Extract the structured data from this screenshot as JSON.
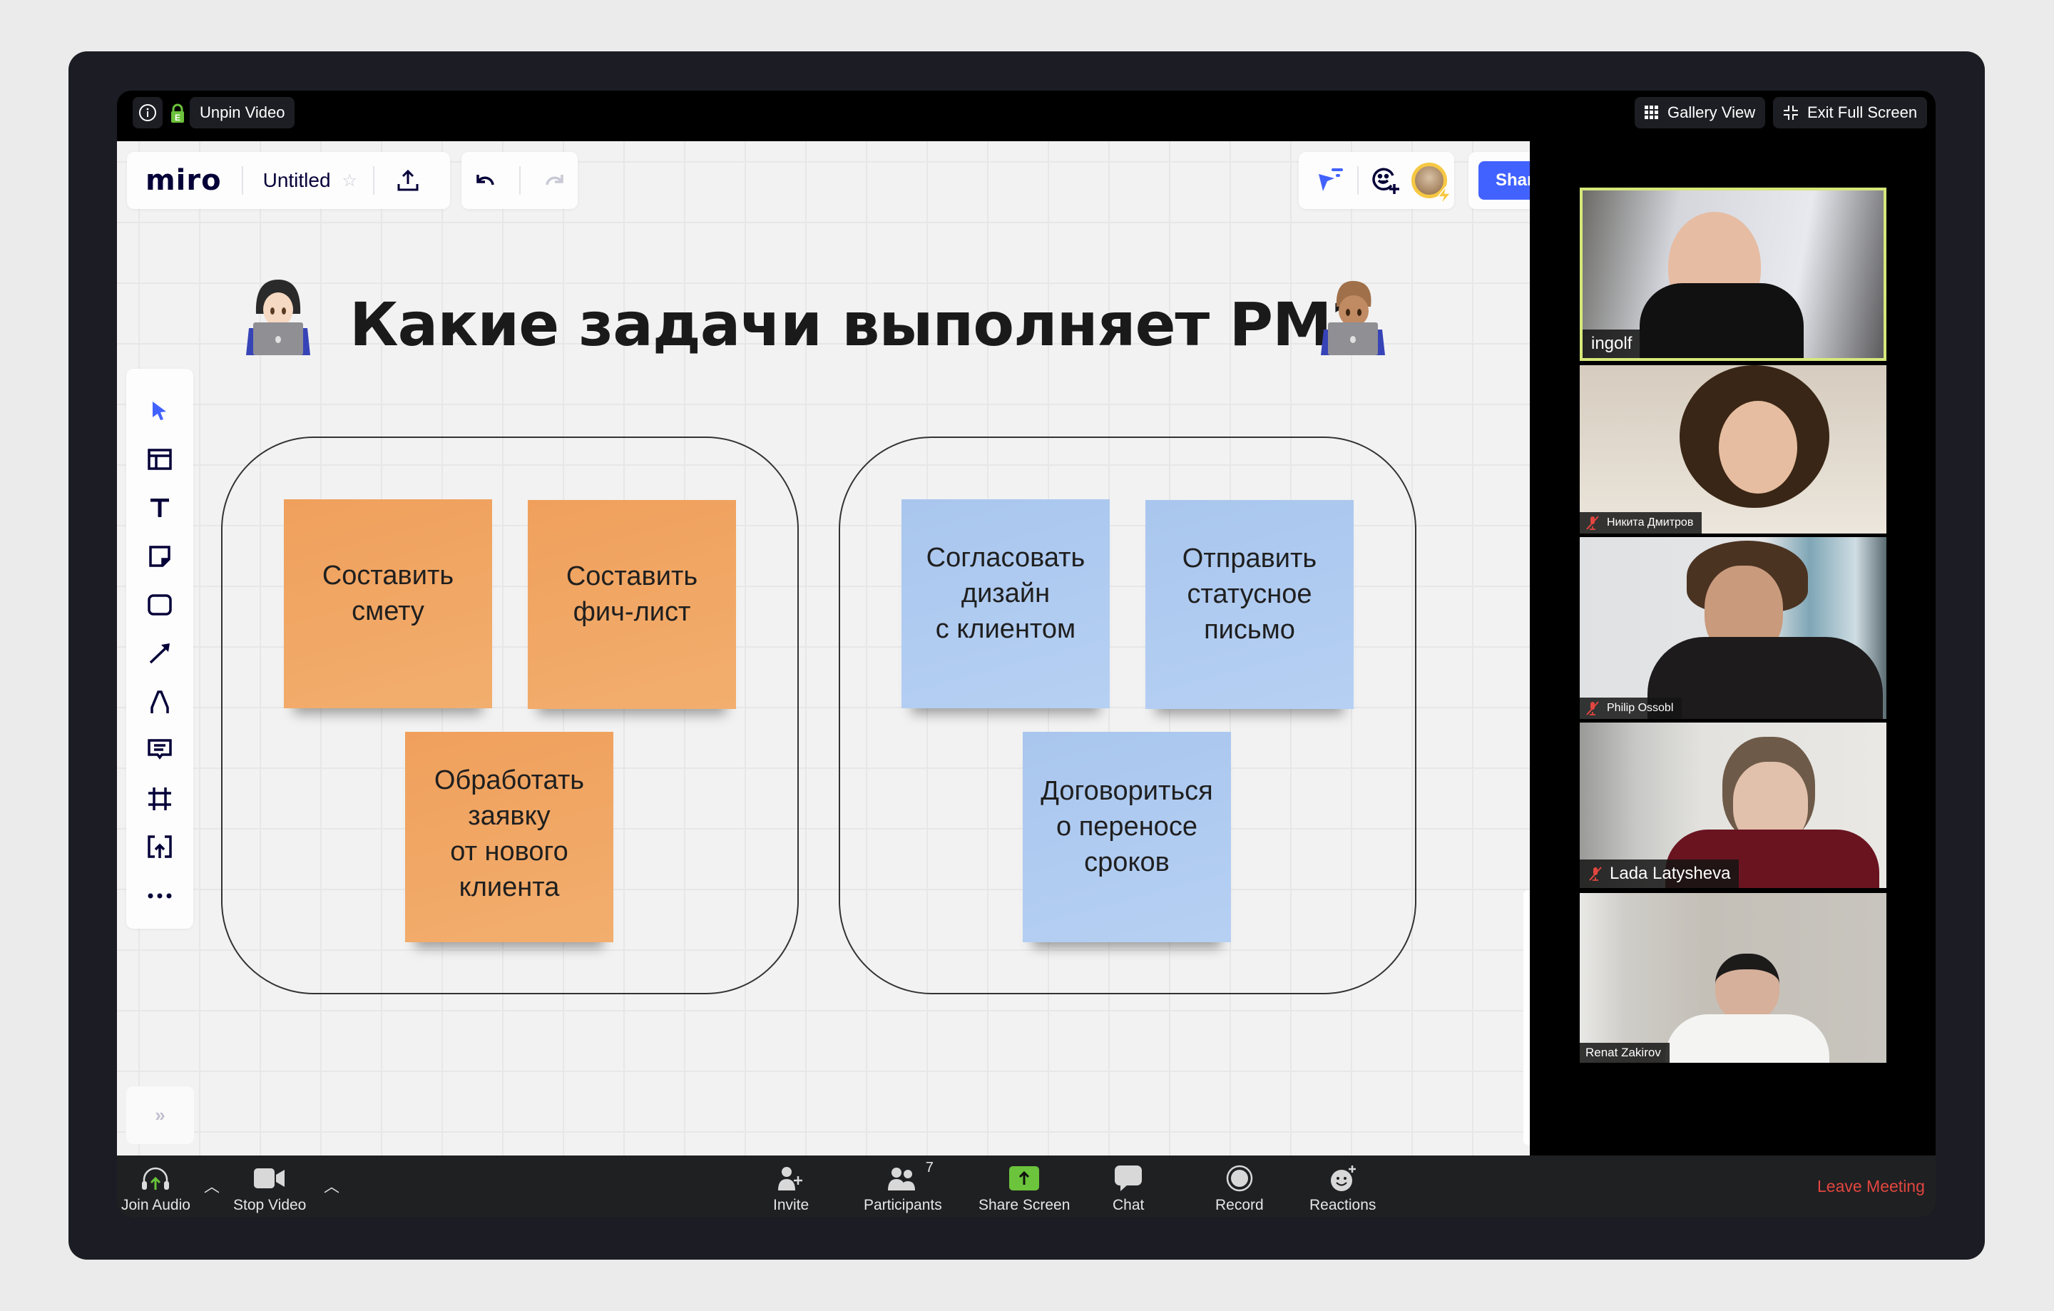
{
  "zoom_top": {
    "unpin_label": "Unpin Video",
    "gallery_label": "Gallery View",
    "exit_fullscreen_label": "Exit Full Screen",
    "lock_letter": "E"
  },
  "miro": {
    "logo": "miro",
    "board_title": "Untitled",
    "share_label": "Share",
    "collapse_glyph": "»",
    "toolbar_tools": [
      "select",
      "templates",
      "text",
      "sticky-note",
      "shape",
      "arrow",
      "pen",
      "comment",
      "frame",
      "upload",
      "more"
    ]
  },
  "board": {
    "heading": "Какие задачи выполняет PM?",
    "groups": [
      {
        "color": "#f2a561",
        "stickies": [
          "Составить\nсмету",
          "Составить\nфич-лист",
          "Обработать\nзаявку\nот нового\nклиента"
        ]
      },
      {
        "color": "#aecbf1",
        "stickies": [
          "Согласовать\nдизайн\nс клиентом",
          "Отправить\nстатусное\nписьмо",
          "Договориться\nо переносе\nсроков"
        ]
      }
    ]
  },
  "participants": [
    {
      "name": "ingolf",
      "muted": false,
      "active_speaker": true
    },
    {
      "name": "Никита Дмитров",
      "muted": true,
      "active_speaker": false
    },
    {
      "name": "Philip Ossobl",
      "muted": true,
      "active_speaker": false
    },
    {
      "name": "Lada Latysheva",
      "muted": true,
      "active_speaker": false
    },
    {
      "name": "Renat Zakirov",
      "muted": false,
      "active_speaker": false
    }
  ],
  "bottom_bar": {
    "join_audio": "Join Audio",
    "stop_video": "Stop Video",
    "invite": "Invite",
    "participants": "Participants",
    "participant_count": "7",
    "share_screen": "Share Screen",
    "chat": "Chat",
    "record": "Record",
    "reactions": "Reactions",
    "leave": "Leave Meeting"
  },
  "colors": {
    "miro_accent": "#4262ff",
    "share_screen_green": "#6bc43b",
    "leave_red": "#e2463f",
    "active_speaker_border": "#d7e87a"
  }
}
